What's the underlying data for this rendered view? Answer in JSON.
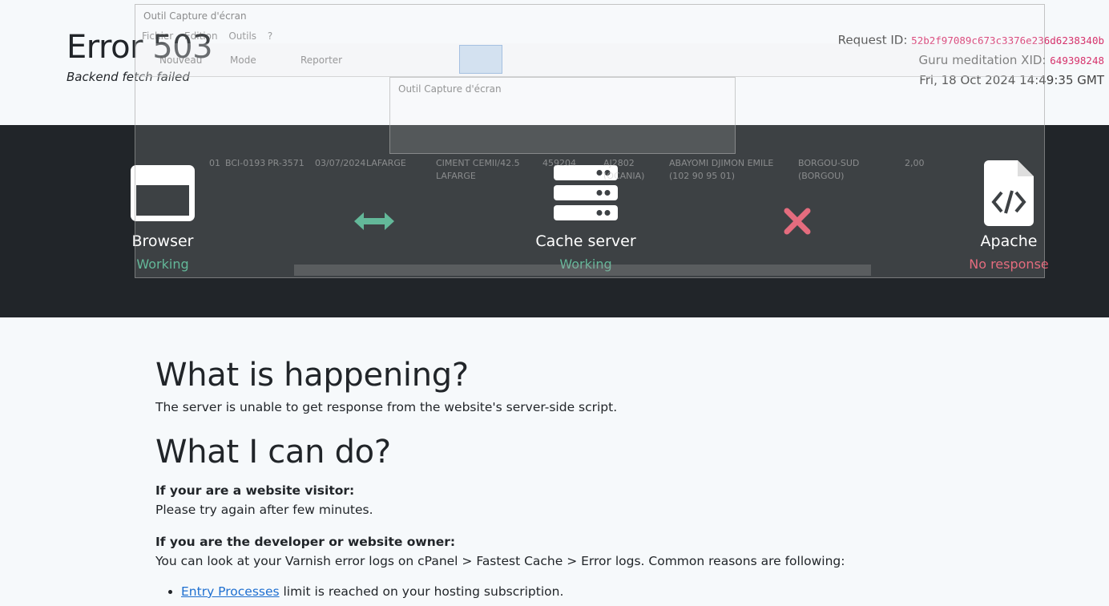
{
  "header": {
    "title": "Error 503",
    "subtitle": "Backend fetch failed",
    "request_label": "Request ID:",
    "request_id": "52b2f97089c673c3376e236d6238340b",
    "xid_label": "Guru meditation XID:",
    "xid": "649398248",
    "date": "Fri, 18 Oct 2024 14:49:35 GMT"
  },
  "diagram": {
    "nodes": [
      {
        "name": "Browser",
        "status": "Working",
        "icon": "browser-window-icon"
      },
      {
        "name": "Cache server",
        "status": "Working",
        "icon": "server-stack-icon"
      },
      {
        "name": "Apache",
        "status": "No response",
        "icon": "file-code-icon"
      }
    ],
    "links": [
      {
        "icon": "double-arrow-icon",
        "color": "#4cae8a"
      },
      {
        "icon": "cross-icon",
        "color": "#e0576b"
      }
    ],
    "colors": {
      "band": "#212529",
      "ok": "#4cae8a",
      "bad": "#e0576b"
    }
  },
  "overlay": {
    "title": "Outil Capture d'écran",
    "menu": "Fichier Edition Outils ?",
    "toolbar": [
      "Nouveau",
      "Mode",
      "Reporter"
    ],
    "dialog_title": "Outil Capture d'écran",
    "row": [
      "01",
      "BCI-0193",
      "PR-3571",
      "03/07/2024",
      "LAFARGE",
      "CIMENT CEMII/42.5 LAFARGE",
      "459204",
      "AJ2802 (OCANIA)",
      "ABAYOMI DJIMON EMILE (102 90 95 01)",
      "BORGOU-SUD (BORGOU)",
      "2,00"
    ]
  },
  "main": {
    "h_happening": "What is happening?",
    "happening_text": "The server is unable to get response from the website's server-side script.",
    "h_cando": "What I can do?",
    "visitor_label": "If your are a website visitor:",
    "visitor_text": "Please try again after few minutes.",
    "owner_label": "If you are the developer or website owner:",
    "owner_text": "You can look at your Varnish error logs on cPanel > Fastest Cache > Error logs. Common reasons are following:",
    "reasons": [
      {
        "link": "Entry Processes",
        "text": " limit is reached on your hosting subscription."
      }
    ]
  }
}
